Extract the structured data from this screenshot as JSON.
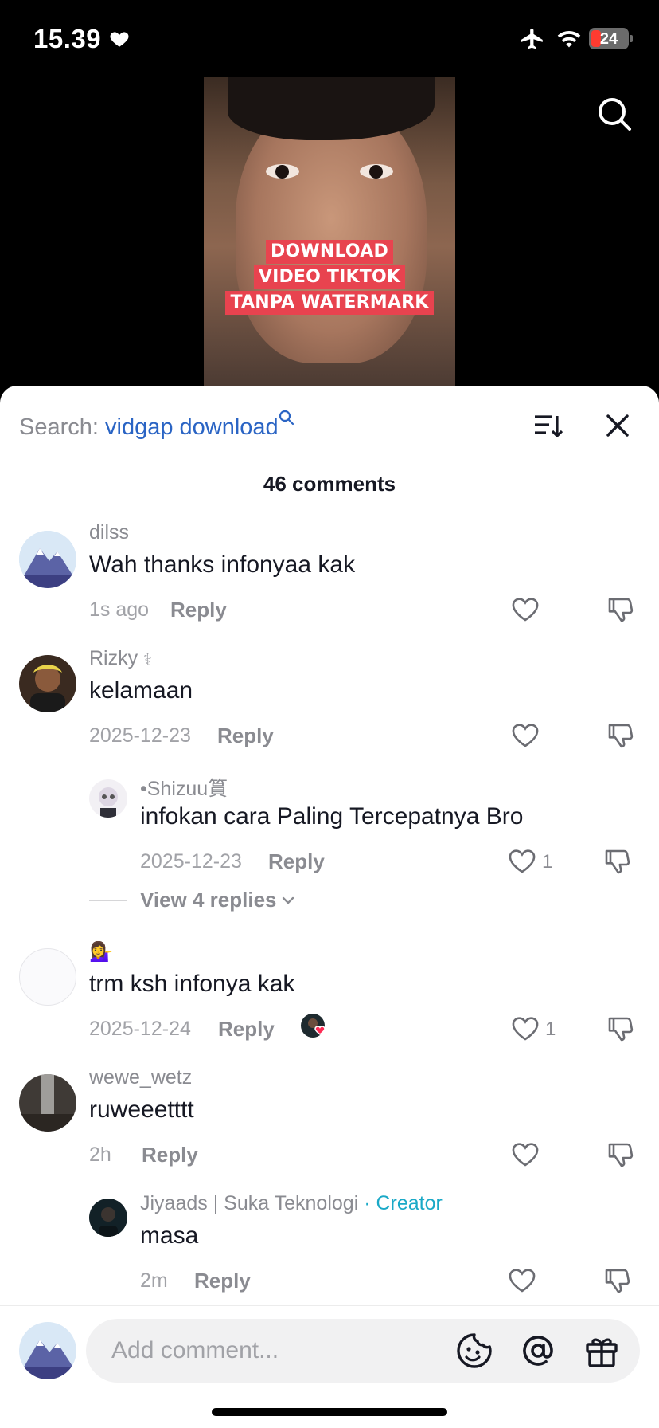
{
  "status_bar": {
    "time": "15.39",
    "battery": "24"
  },
  "video": {
    "title_lines": [
      "DOWNLOAD",
      "VIDEO TIKTOK",
      "TANPA WATERMARK"
    ]
  },
  "sheet": {
    "search_prefix": "Search: ",
    "search_term": "vidgap download",
    "comment_count": "46 comments"
  },
  "comments": [
    {
      "username": "dilss",
      "text": "Wah thanks infonyaa kak",
      "time": "1s ago",
      "reply": "Reply",
      "likes": ""
    },
    {
      "username": "Rizky",
      "badge": "⚕",
      "text": "kelamaan",
      "time": "2025-12-23",
      "reply": "Reply",
      "likes": ""
    },
    {
      "username": "•Shizuu篔",
      "text": "infokan cara Paling Tercepatnya Bro",
      "time": "2025-12-23",
      "reply": "Reply",
      "likes": "1"
    },
    {
      "username": "💁‍♀️",
      "text": "trm ksh infonya kak",
      "time": "2025-12-24",
      "reply": "Reply",
      "likes": "1"
    },
    {
      "username": "wewe_wetz",
      "text": "ruweeetttt",
      "time": "2h",
      "reply": "Reply",
      "likes": ""
    },
    {
      "username": "Jiyaads | Suka Teknologi",
      "creator_tag": " · Creator",
      "text": "masa",
      "time": "2m",
      "reply": "Reply",
      "likes": ""
    }
  ],
  "view_replies": "View 4 replies",
  "bottom_bar": {
    "placeholder": "Add comment..."
  },
  "colors": {
    "accent_blue": "#2a64c4",
    "creator_cyan": "#1aa9c7",
    "video_label_red": "#e8434f"
  },
  "icons": [
    "heart-icon",
    "airplane-icon",
    "wifi-icon",
    "search-icon",
    "sort-icon",
    "close-icon",
    "like-icon",
    "dislike-icon",
    "chevron-down-icon",
    "emoji-icon",
    "mention-icon",
    "gift-icon"
  ]
}
